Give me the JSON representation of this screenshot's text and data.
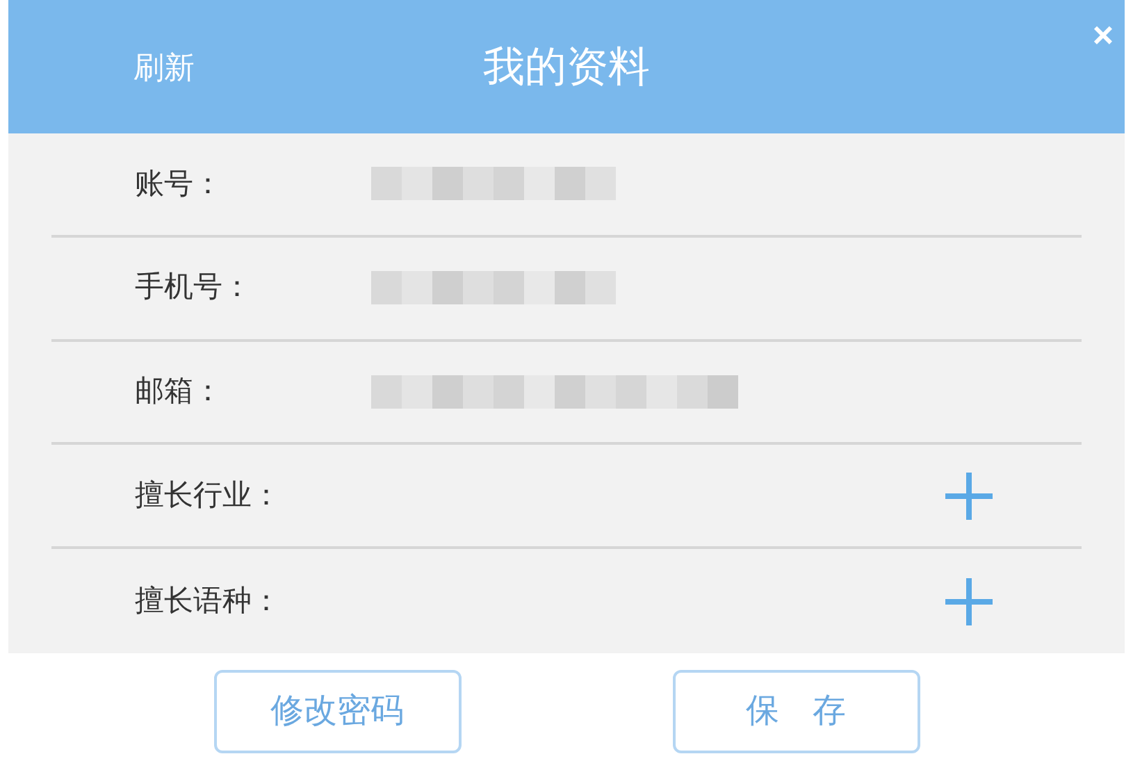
{
  "header": {
    "refresh": "刷新",
    "title": "我的资料",
    "close": "×"
  },
  "fields": [
    {
      "label": "账号：",
      "kind": "masked"
    },
    {
      "label": "手机号：",
      "kind": "masked"
    },
    {
      "label": "邮箱：",
      "kind": "masked"
    },
    {
      "label": "擅长行业：",
      "kind": "add"
    },
    {
      "label": "擅长语种：",
      "kind": "add"
    }
  ],
  "buttons": [
    "修改密码",
    "保　存"
  ]
}
